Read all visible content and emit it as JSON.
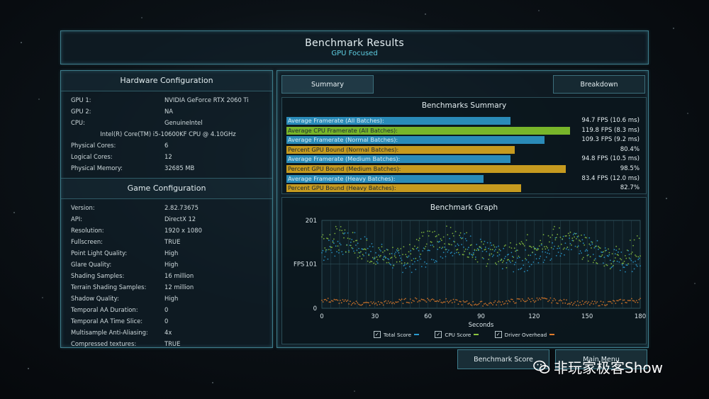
{
  "title": {
    "main": "Benchmark Results",
    "sub": "GPU Focused"
  },
  "hardware": {
    "heading": "Hardware Configuration",
    "rows": [
      {
        "label": "GPU 1:",
        "value": "NVIDIA GeForce RTX 2060 Ti"
      },
      {
        "label": "GPU 2:",
        "value": "NA"
      },
      {
        "label": "CPU:",
        "value": "GenuineIntel"
      }
    ],
    "cpu_model": "Intel(R) Core(TM) i5-10600KF CPU @ 4.10GHz",
    "rows2": [
      {
        "label": "Physical Cores:",
        "value": "6"
      },
      {
        "label": "Logical Cores:",
        "value": "12"
      },
      {
        "label": "Physical Memory:",
        "value": "32685  MB"
      }
    ]
  },
  "game": {
    "heading": "Game Configuration",
    "rows": [
      {
        "label": "Version:",
        "value": "2.82.73675"
      },
      {
        "label": "API:",
        "value": "DirectX 12"
      },
      {
        "label": "Resolution:",
        "value": "1920 x 1080"
      },
      {
        "label": "Fullscreen:",
        "value": "TRUE"
      },
      {
        "label": "Point Light Quality:",
        "value": "High"
      },
      {
        "label": "Glare Quality:",
        "value": "High"
      },
      {
        "label": "Shading Samples:",
        "value": "16 million"
      },
      {
        "label": "Terrain Shading Samples:",
        "value": "12 million"
      },
      {
        "label": "Shadow Quality:",
        "value": "High"
      },
      {
        "label": "Temporal AA Duration:",
        "value": "0"
      },
      {
        "label": "Temporal AA Time Slice:",
        "value": "0"
      },
      {
        "label": "Multisample Anti-Aliasing:",
        "value": "4x"
      },
      {
        "label": "Compressed textures:",
        "value": "TRUE"
      }
    ]
  },
  "tabs": {
    "summary": "Summary",
    "breakdown": "Breakdown"
  },
  "summary": {
    "heading": "Benchmarks Summary",
    "bars": [
      {
        "label": "Average Framerate (All Batches):",
        "value": "94.7 FPS (10.6 ms)",
        "fraction": 0.79,
        "color": "blue"
      },
      {
        "label": "Average CPU Framerate (All Batches):",
        "value": "119.8 FPS (8.3 ms)",
        "fraction": 1.0,
        "color": "green"
      },
      {
        "label": "Average Framerate (Normal Batches):",
        "value": "109.3 FPS (9.2 ms)",
        "fraction": 0.91,
        "color": "blue"
      },
      {
        "label": "Percent GPU Bound (Normal Batches):",
        "value": "80.4%",
        "fraction": 0.804,
        "color": "gold"
      },
      {
        "label": "Average Framerate (Medium Batches):",
        "value": "94.8 FPS (10.5 ms)",
        "fraction": 0.79,
        "color": "blue"
      },
      {
        "label": "Percent GPU Bound (Medium Batches):",
        "value": "98.5%",
        "fraction": 0.985,
        "color": "gold"
      },
      {
        "label": "Average Framerate (Heavy Batches):",
        "value": "83.4 FPS (12.0 ms)",
        "fraction": 0.696,
        "color": "blue"
      },
      {
        "label": "Percent GPU Bound (Heavy Batches):",
        "value": "82.7%",
        "fraction": 0.827,
        "color": "gold"
      }
    ]
  },
  "colors": {
    "total": "#2a9bd0",
    "cpu": "#8cc63f",
    "driver": "#e07b2a",
    "blue_bar": "#2a8bb8",
    "green_bar": "#78b52a",
    "gold_bar": "#c69a1f"
  },
  "chart_data": {
    "type": "scatter",
    "title": "Benchmark Graph",
    "xlabel": "Seconds",
    "ylabel": "FPS",
    "xlim": [
      0,
      180
    ],
    "ylim": [
      0,
      201
    ],
    "x_ticks": [
      "0",
      "30",
      "60",
      "90",
      "120",
      "150",
      "180"
    ],
    "y_ticks": [
      "201",
      "101",
      "0"
    ],
    "series": [
      {
        "name": "Total Score",
        "approx_range": [
          80,
          175
        ]
      },
      {
        "name": "CPU Score",
        "approx_range": [
          90,
          190
        ]
      },
      {
        "name": "Driver Overhead",
        "approx_range": [
          5,
          25
        ]
      }
    ],
    "legend": "bottom",
    "grid": true
  },
  "buttons": {
    "score": "Benchmark Score",
    "menu": "Main Menu"
  },
  "watermark": "非玩家极客Show"
}
